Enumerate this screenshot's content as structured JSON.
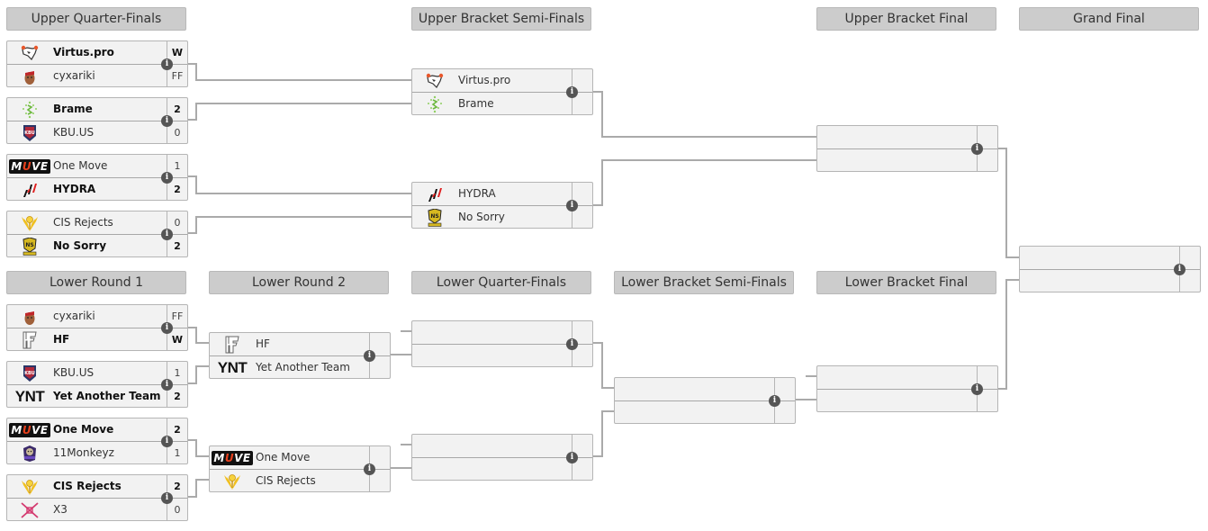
{
  "headers": {
    "upper_quarter_finals": "Upper Quarter-Finals",
    "upper_semi_finals": "Upper Bracket Semi-Finals",
    "upper_final": "Upper Bracket Final",
    "grand_final": "Grand Final",
    "lower_round_1": "Lower Round 1",
    "lower_round_2": "Lower Round 2",
    "lower_quarter_finals": "Lower Quarter-Finals",
    "lower_semi_finals": "Lower Bracket Semi-Finals",
    "lower_final": "Lower Bracket Final"
  },
  "info_glyph": "i",
  "matches": {
    "uqf1": {
      "top": {
        "name": "Virtus.pro",
        "score": "W",
        "winner": true,
        "logo": "virtus-pro-logo"
      },
      "bot": {
        "name": "cyxariki",
        "score": "FF",
        "winner": false,
        "logo": "cyxariki-logo"
      }
    },
    "uqf2": {
      "top": {
        "name": "Brame",
        "score": "2",
        "winner": true,
        "logo": "brame-logo"
      },
      "bot": {
        "name": "KBU.US",
        "score": "0",
        "winner": false,
        "logo": "kbu-us-logo"
      }
    },
    "uqf3": {
      "top": {
        "name": "One Move",
        "score": "1",
        "winner": false,
        "logo": "one-move-logo"
      },
      "bot": {
        "name": "HYDRA",
        "score": "2",
        "winner": true,
        "logo": "hydra-logo"
      }
    },
    "uqf4": {
      "top": {
        "name": "CIS Rejects",
        "score": "0",
        "winner": false,
        "logo": "cis-rejects-logo"
      },
      "bot": {
        "name": "No Sorry",
        "score": "2",
        "winner": true,
        "logo": "no-sorry-logo"
      }
    },
    "usf1": {
      "top": {
        "name": "Virtus.pro",
        "score": "",
        "winner": false,
        "logo": "virtus-pro-logo"
      },
      "bot": {
        "name": "Brame",
        "score": "",
        "winner": false,
        "logo": "brame-logo"
      }
    },
    "usf2": {
      "top": {
        "name": "HYDRA",
        "score": "",
        "winner": false,
        "logo": "hydra-logo"
      },
      "bot": {
        "name": "No Sorry",
        "score": "",
        "winner": false,
        "logo": "no-sorry-logo"
      }
    },
    "ubf": {
      "top": {
        "name": "",
        "score": ""
      },
      "bot": {
        "name": "",
        "score": ""
      }
    },
    "gf": {
      "top": {
        "name": "",
        "score": ""
      },
      "bot": {
        "name": "",
        "score": ""
      }
    },
    "lr1a": {
      "top": {
        "name": "cyxariki",
        "score": "FF",
        "winner": false,
        "logo": "cyxariki-logo"
      },
      "bot": {
        "name": "HF",
        "score": "W",
        "winner": true,
        "logo": "hf-logo"
      }
    },
    "lr1b": {
      "top": {
        "name": "KBU.US",
        "score": "1",
        "winner": false,
        "logo": "kbu-us-logo"
      },
      "bot": {
        "name": "Yet Another Team",
        "score": "2",
        "winner": true,
        "logo": "ynt-logo"
      }
    },
    "lr1c": {
      "top": {
        "name": "One Move",
        "score": "2",
        "winner": true,
        "logo": "one-move-logo"
      },
      "bot": {
        "name": "11Monkeyz",
        "score": "1",
        "winner": false,
        "logo": "11monkeyz-logo"
      }
    },
    "lr1d": {
      "top": {
        "name": "CIS Rejects",
        "score": "2",
        "winner": true,
        "logo": "cis-rejects-logo"
      },
      "bot": {
        "name": "X3",
        "score": "0",
        "winner": false,
        "logo": "x3-logo"
      }
    },
    "lr2a": {
      "top": {
        "name": "HF",
        "score": "",
        "winner": false,
        "logo": "hf-logo"
      },
      "bot": {
        "name": "Yet Another Team",
        "score": "",
        "winner": false,
        "logo": "ynt-logo"
      }
    },
    "lr2b": {
      "top": {
        "name": "One Move",
        "score": "",
        "winner": false,
        "logo": "one-move-logo"
      },
      "bot": {
        "name": "CIS Rejects",
        "score": "",
        "winner": false,
        "logo": "cis-rejects-logo"
      }
    },
    "lqf1": {
      "top": {
        "name": "",
        "score": ""
      },
      "bot": {
        "name": "",
        "score": ""
      }
    },
    "lqf2": {
      "top": {
        "name": "",
        "score": ""
      },
      "bot": {
        "name": "",
        "score": ""
      }
    },
    "lsf": {
      "top": {
        "name": "",
        "score": ""
      },
      "bot": {
        "name": "",
        "score": ""
      }
    },
    "lf": {
      "top": {
        "name": "",
        "score": ""
      },
      "bot": {
        "name": "",
        "score": ""
      }
    }
  },
  "logo_text": {
    "one_move": {
      "pre": "M",
      "mid": "U",
      "post": "VE"
    },
    "ynt": "YNT"
  },
  "colors": {
    "header_bg": "#cccccc",
    "match_bg": "#f2f2f2",
    "connector": "#aaaaaa",
    "info_icon": "#555555"
  }
}
